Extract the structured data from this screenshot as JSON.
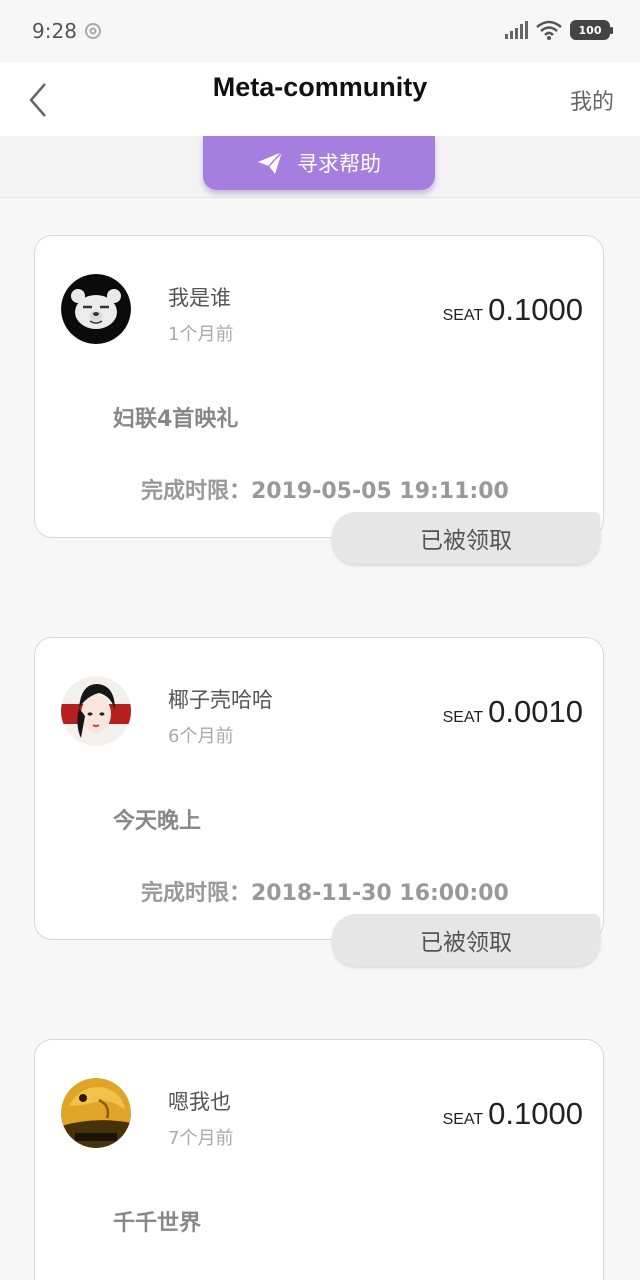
{
  "status_bar": {
    "time": "9:28",
    "battery": "100",
    "icons": [
      "sync-ring-icon",
      "signal-icon",
      "wifi-icon",
      "battery-icon"
    ]
  },
  "nav": {
    "back_icon": "chevron-left-icon",
    "title": "Meta-community",
    "right_label": "我的"
  },
  "help_button": {
    "icon": "paper-plane-icon",
    "label": "寻求帮助",
    "color": "#a57ee0"
  },
  "posts": [
    {
      "username": "我是谁",
      "time_ago": "1个月前",
      "reward_unit": "SEAT",
      "reward_amount": "0.1000",
      "title": "妇联4首映礼",
      "deadline": "完成时限：2019-05-05 19:11:00",
      "status_label": "已被领取",
      "avatar": "bear-avatar"
    },
    {
      "username": "椰子壳哈哈",
      "time_ago": "6个月前",
      "reward_unit": "SEAT",
      "reward_amount": "0.0010",
      "title": "今天晚上",
      "deadline": "完成时限：2018-11-30 16:00:00",
      "status_label": "已被领取",
      "avatar": "girl-avatar"
    },
    {
      "username": "嗯我也",
      "time_ago": "7个月前",
      "reward_unit": "SEAT",
      "reward_amount": "0.1000",
      "title": "千千世界",
      "avatar": "yellow-avatar"
    }
  ]
}
